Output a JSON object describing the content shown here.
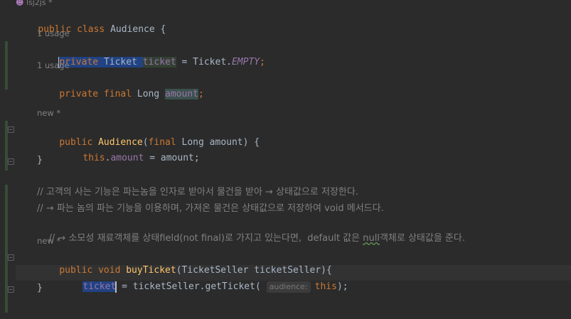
{
  "header": {
    "author": "lsj2js *"
  },
  "hints": {
    "usage1": "1 usage",
    "usage2": "1 usage",
    "new1": "new *",
    "new2": "new *"
  },
  "code": {
    "class_decl_kw": "public class ",
    "class_name": "Audience {",
    "l1_private": "private ",
    "l1_type": "Ticket ",
    "l1_field": "ticket",
    "l1_eq": " = Ticket.",
    "l1_const": "EMPTY",
    "l1_end": ";",
    "l2_mods": "private final ",
    "l2_type": "Long ",
    "l2_field": "amount",
    "l2_end": ";",
    "ctor_mod": "public ",
    "ctor_name": "Audience",
    "ctor_params_open": "(",
    "ctor_final": "final ",
    "ctor_params_rest": "Long amount) {",
    "ctor_this": "this",
    "ctor_dot": ".",
    "ctor_field": "amount",
    "ctor_assign": " = amount;",
    "close1": "}",
    "comment1": "// 고객의 사는 기능은 파는놈을 인자로 받아서 물건을 받아 → 상태값으로 저장한다.",
    "comment2": "// → 파는 놈의 파는 기능을 이용하며, 가져온 물건은 상태값으로 저장하여 void 메서드다.",
    "comment3_a": "// → 소모성 재료객체를 상태",
    "comment3_b": "field",
    "comment3_c": "(not final)로 가지고 있는다면,  default 값은 ",
    "comment3_d": "null",
    "comment3_e": "객체로 상태값을 준다.",
    "buy_mod": "public void ",
    "buy_name": "buyTicket",
    "buy_params": "(TicketSeller ticketSeller){",
    "buy_field": "ticket",
    "buy_rest": " = ticketSeller.getTicket( ",
    "buy_param_hint": "audience:",
    "buy_this": "this",
    "buy_end": ");",
    "close2": "}"
  }
}
